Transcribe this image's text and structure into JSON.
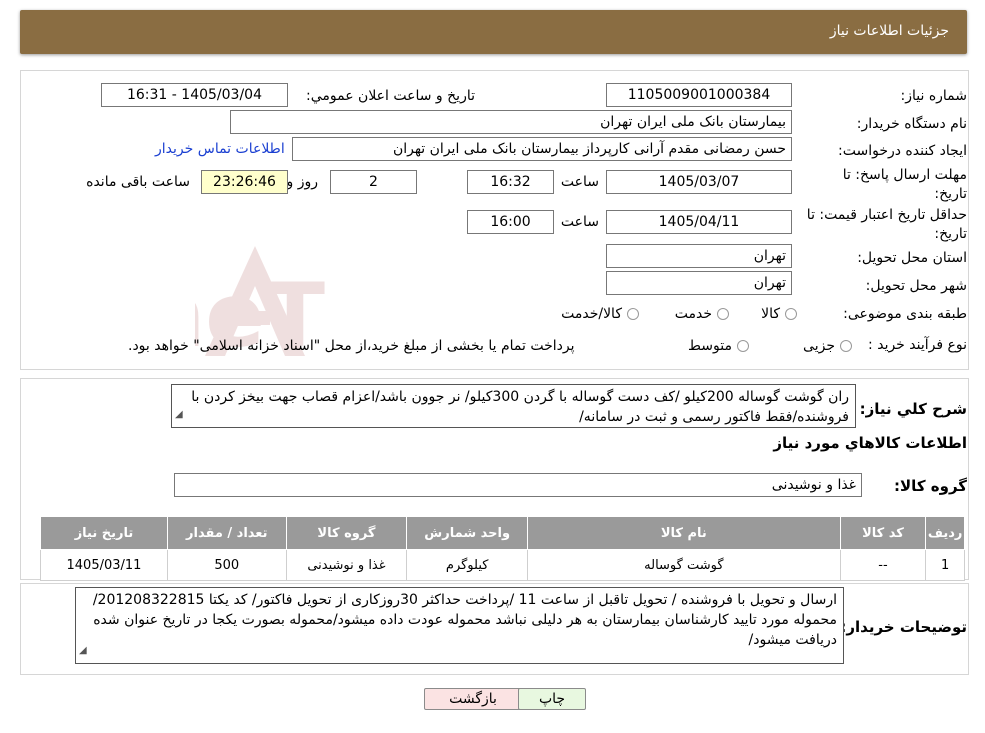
{
  "header": {
    "title": "جزئیات اطلاعات نیاز"
  },
  "form": {
    "need_number_label": "شماره نیاز:",
    "need_number": "1105009001000384",
    "announce_label": "تاریخ و ساعت اعلان عمومي:",
    "announce_value": "1405/03/04 - 16:31",
    "buyer_org_label": "نام دستگاه خریدار:",
    "buyer_org": "بیمارستان بانک ملی ایران تهران",
    "creator_label": "ایجاد کننده درخواست:",
    "creator": "حسن رمضانی مقدم آرانی کارپرداز بیمارستان بانک ملی ایران تهران",
    "contact_link": "اطلاعات تماس خریدار",
    "deadline_label_1": "مهلت ارسال پاسخ: تا",
    "deadline_label_2": "تاریخ:",
    "deadline_date": "1405/03/07",
    "time_label": "ساعت",
    "deadline_time": "16:32",
    "days_value": "2",
    "days_label": "روز و",
    "remaining_time": "23:26:46",
    "remaining_label": "ساعت باقی مانده",
    "validity_label_1": "حداقل تاریخ اعتبار قیمت: تا",
    "validity_label_2": "تاریخ:",
    "validity_date": "1405/04/11",
    "validity_time": "16:00",
    "province_label": "استان محل تحویل:",
    "province": "تهران",
    "city_label": "شهر محل تحویل:",
    "city": "تهران",
    "category_label": "طبقه بندی موضوعی:",
    "category_options": [
      "کالا",
      "خدمت",
      "کالا/خدمت"
    ],
    "process_label": "نوع فرآیند خرید :",
    "process_options": [
      "جزیی",
      "متوسط"
    ],
    "process_note": "پرداخت تمام یا بخشی از مبلغ خرید،از محل \"اسناد خزانه اسلامی\" خواهد بود."
  },
  "summary": {
    "label": "شرح کلي نیاز:",
    "text": "ران گوشت گوساله 200کیلو /کف دست گوساله با گردن 300کیلو/ نر جوون باشد/اعزام قصاب جهت بیخز کردن با فروشنده/فقط فاکتور رسمی و ثبت در سامانه/"
  },
  "goods": {
    "section_title": "اطلاعات کالاهاي مورد نیاز",
    "group_label": "گروه کالا:",
    "group_value": "غذا و نوشیدنی",
    "columns": [
      "ردیف",
      "کد کالا",
      "نام کالا",
      "واحد شمارش",
      "گروه کالا",
      "تعداد / مقدار",
      "تاریخ نیاز"
    ],
    "rows": [
      [
        "1",
        "--",
        "گوشت گوساله",
        "کیلوگرم",
        "غذا و نوشیدنی",
        "500",
        "1405/03/11"
      ]
    ]
  },
  "buyer_notes": {
    "label": "توضیحات خریدار:",
    "text": "ارسال و تحویل با فروشنده / تحویل تاقبل از ساعت 11 /پرداخت حداکثر 30روزکاری از تحویل فاکتور/ کد یکتا 201208322815/ محموله مورد تایید کارشناسان بیمارستان به هر دلیلی نباشد محموله عودت داده میشود/محموله بصورت یکجا در تاریخ عنوان شده دریافت میشود/"
  },
  "buttons": {
    "print": "چاپ",
    "back": "بازگشت"
  },
  "watermark": {
    "text": "AriaTender.neT"
  },
  "colors": {
    "title_bg": "#8a6d42",
    "table_header": "#9a9a9a",
    "highlight": "#ffffcc",
    "link": "#1a3fd1",
    "back_button": "#fbe3e3",
    "print_button": "#e8f8e0"
  }
}
